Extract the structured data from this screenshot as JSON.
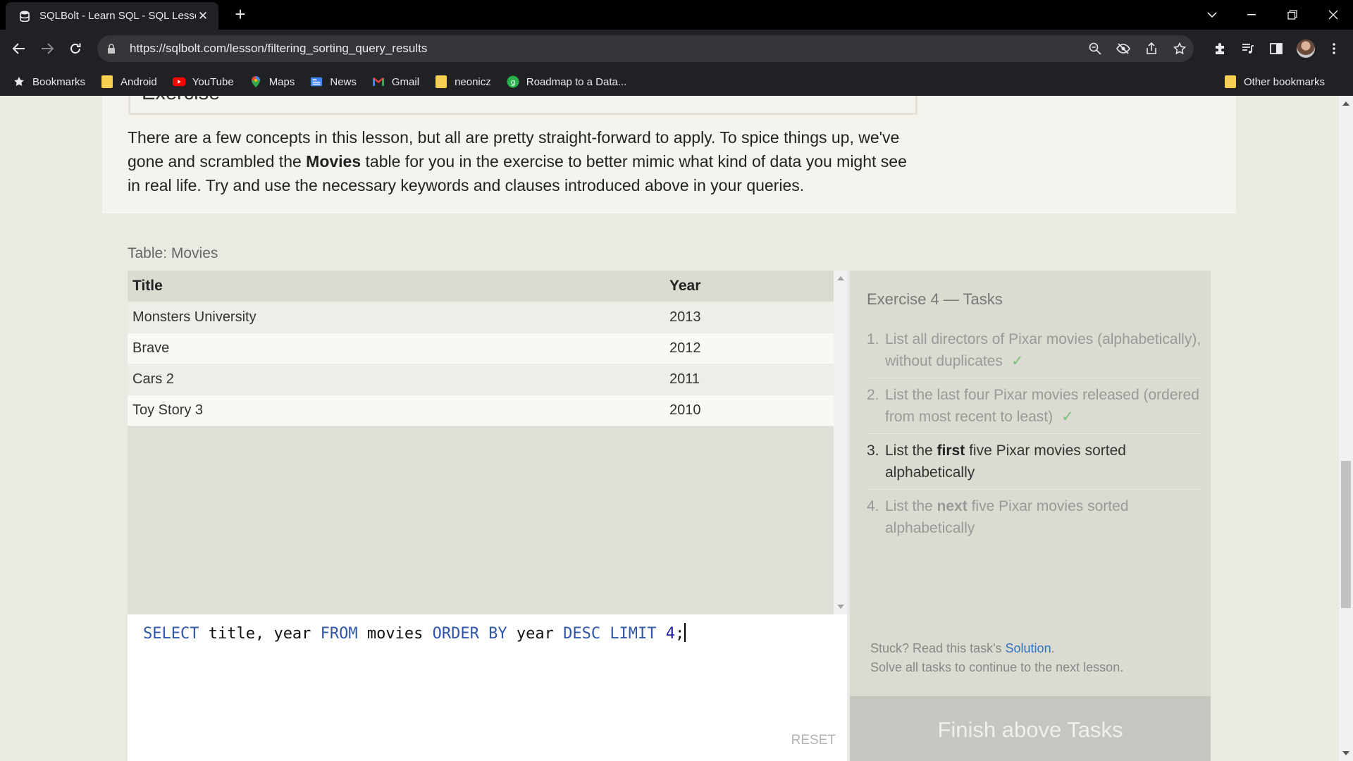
{
  "browser": {
    "tab_title": "SQLBolt - Learn SQL - SQL Lesson",
    "url": "https://sqlbolt.com/lesson/filtering_sorting_query_results",
    "bookmarks": [
      {
        "label": "Bookmarks",
        "icon": "star-icon"
      },
      {
        "label": "Android",
        "icon": "folder-icon"
      },
      {
        "label": "YouTube",
        "icon": "youtube-icon"
      },
      {
        "label": "Maps",
        "icon": "maps-icon"
      },
      {
        "label": "News",
        "icon": "news-icon"
      },
      {
        "label": "Gmail",
        "icon": "gmail-icon"
      },
      {
        "label": "neonicz",
        "icon": "folder-icon"
      },
      {
        "label": "Roadmap to a Data...",
        "icon": "roadmap-icon"
      }
    ],
    "other_bookmarks": "Other bookmarks"
  },
  "lesson": {
    "heading": "Exercise",
    "intro_part1": "There are a few concepts in this lesson, but all are pretty straight-forward to apply. To spice things up, we've gone and scrambled the ",
    "intro_bold": "Movies",
    "intro_part2": " table for you in the exercise to better mimic what kind of data you might see in real life. Try and use the necessary keywords and clauses introduced above in your queries."
  },
  "exercise": {
    "table_label": "Table: Movies",
    "columns": [
      "Title",
      "Year"
    ],
    "rows": [
      [
        "Monsters University",
        "2013"
      ],
      [
        "Brave",
        "2012"
      ],
      [
        "Cars 2",
        "2011"
      ],
      [
        "Toy Story 3",
        "2010"
      ]
    ],
    "query_tokens": {
      "select": "SELECT",
      "cols": " title, year ",
      "from": "FROM",
      "tbl": " movies ",
      "orderby": "ORDER BY",
      "col": " year ",
      "desc": "DESC",
      "limit": "LIMIT",
      "n": "4",
      "end": ";"
    },
    "reset_label": "RESET",
    "tasks_title": "Exercise 4 — Tasks",
    "tasks": [
      {
        "num": "1.",
        "text_a": "List all directors of Pixar movies (alphabetically), without duplicates",
        "check": "✓"
      },
      {
        "num": "2.",
        "text_a": "List the last four Pixar movies released (ordered from most recent to least)",
        "check": "✓"
      },
      {
        "num": "3.",
        "text_a": "List the ",
        "bold": "first",
        "text_b": " five Pixar movies sorted alphabetically"
      },
      {
        "num": "4.",
        "text_a": "List the ",
        "bold": "next",
        "text_b": " five Pixar movies sorted alphabetically"
      }
    ],
    "help_prefix": "Stuck? Read this task's ",
    "help_link": "Solution",
    "help_suffix": ".",
    "help_line2": "Solve all tasks to continue to the next lesson.",
    "finish_label": "Finish above Tasks"
  }
}
